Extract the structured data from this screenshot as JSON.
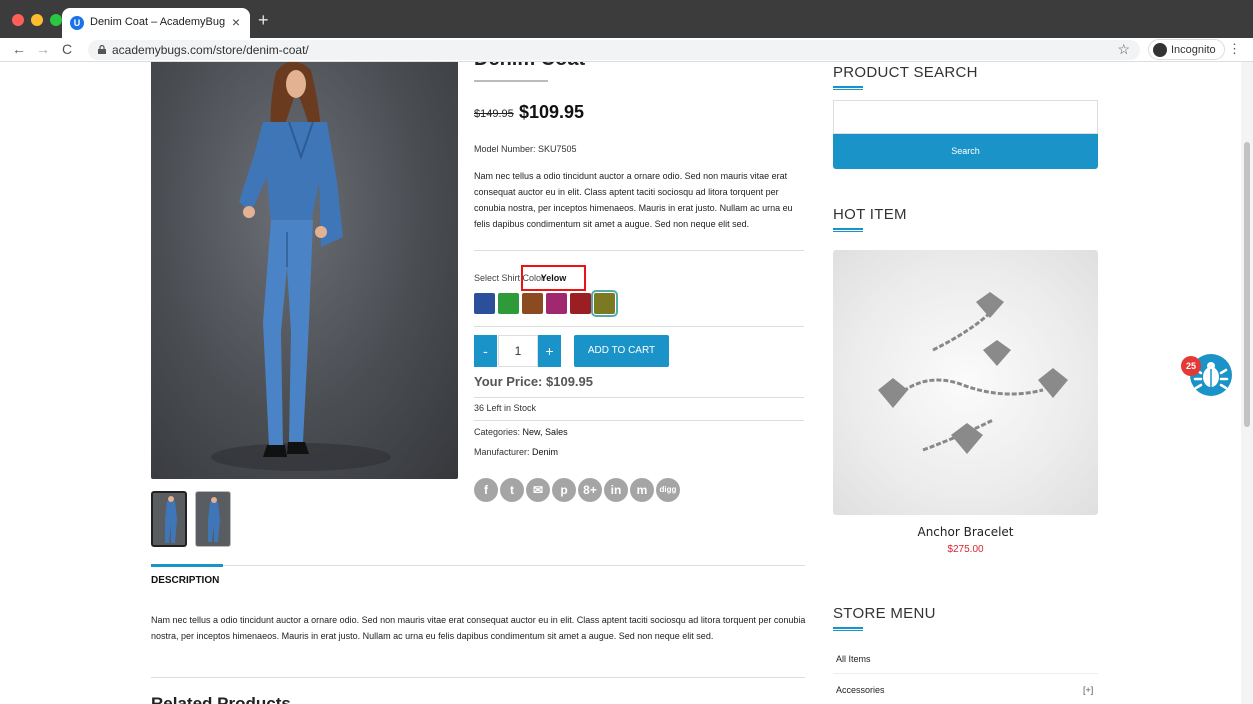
{
  "browser": {
    "tab_title": "Denim Coat – AcademyBugs.co",
    "favicon_letter": "U",
    "url": "academybugs.com/store/denim-coat/",
    "incognito_label": "Incognito"
  },
  "product": {
    "title": "Denim Coat",
    "old_price": "$149.95",
    "new_price": "$109.95",
    "model": "Model Number: SKU7505",
    "description": "Nam nec tellus a odio tincidunt auctor a ornare odio. Sed non mauris vitae erat consequat auctor eu in elit. Class aptent taciti sociosqu ad litora torquent per conubia nostra, per inceptos himenaeos. Mauris in erat justo. Nullam ac urna eu felis dapibus condimentum sit amet a augue. Sed non neque elit sed.",
    "color_label": "Select Shirt Color",
    "color_value": "Yelow",
    "swatches": [
      "#2b4f9a",
      "#2f9a3a",
      "#8b4a20",
      "#a0286e",
      "#9b1f22",
      "#7b7a22"
    ],
    "qty_minus": "-",
    "qty_value": "1",
    "qty_plus": "+",
    "add_to_cart": "ADD TO CART",
    "your_price": "Your Price: $109.95",
    "stock": "36 Left in Stock",
    "categories_label": "Categories:",
    "categories": "New, Sales",
    "manufacturer_label": "Manufacturer:",
    "manufacturer": "Denim",
    "social": [
      "f",
      "t",
      "✉",
      "p",
      "8+",
      "in",
      "m",
      "digg"
    ]
  },
  "tabs": {
    "description_heading": "DESCRIPTION",
    "description_body": "Nam nec tellus a odio tincidunt auctor a ornare odio. Sed non mauris vitae erat consequat auctor eu in elit. Class aptent taciti sociosqu ad litora torquent per conubia nostra, per inceptos himenaeos. Mauris in erat justo. Nullam ac urna eu felis dapibus condimentum sit amet a augue. Sed non neque elit sed.",
    "related_heading": "Related Products"
  },
  "sidebar": {
    "search_title": "PRODUCT SEARCH",
    "search_button": "Search",
    "hot_title": "HOT ITEM",
    "hot_name": "Anchor Bracelet",
    "hot_price": "$275.00",
    "menu_title": "STORE MENU",
    "menu_items": [
      {
        "label": "All Items",
        "expand": ""
      },
      {
        "label": "Accessories",
        "expand": "[+]"
      }
    ]
  },
  "widget": {
    "badge_count": "25"
  },
  "colors": {
    "accent": "#1a93c8",
    "sale_red": "#d9232d",
    "highlight_red": "#ee1111"
  }
}
